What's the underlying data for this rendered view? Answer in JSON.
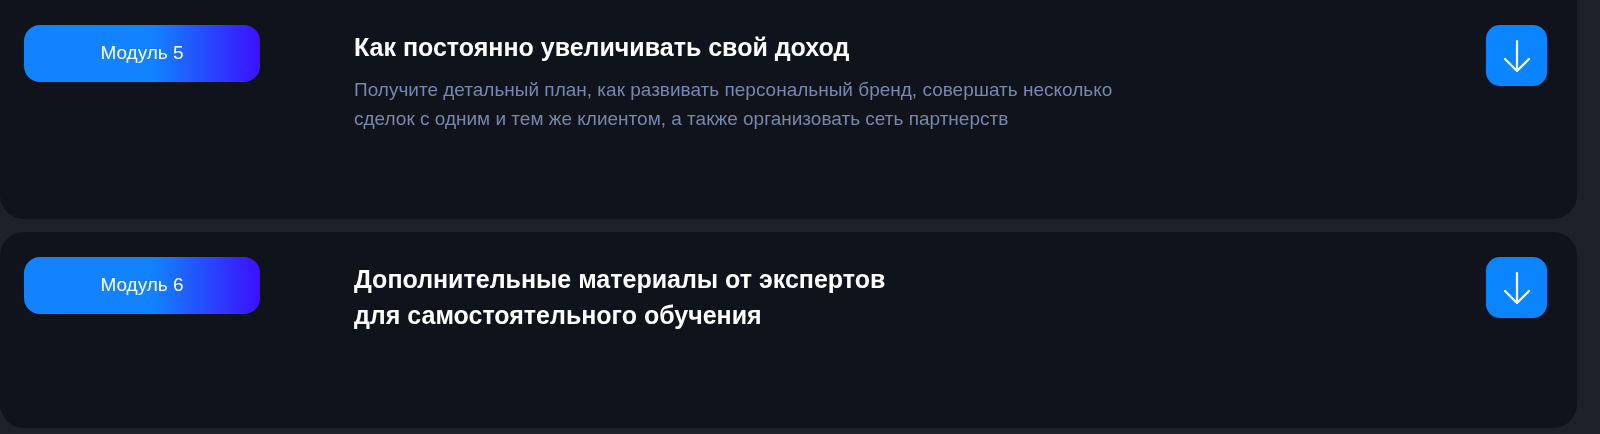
{
  "modules": [
    {
      "badge": "Модуль 5",
      "title": "Как постоянно увеличивать свой доход",
      "description": "Получите детальный план, как развивать персональный бренд, совершать несколько\nсделок с одним и тем же клиентом, а также организовать сеть партнерств",
      "expanded": false
    },
    {
      "badge": "Модуль 6",
      "title": "Дополнительные материалы от экспертов\nдля самостоятельного обучения",
      "expanded": false
    }
  ]
}
